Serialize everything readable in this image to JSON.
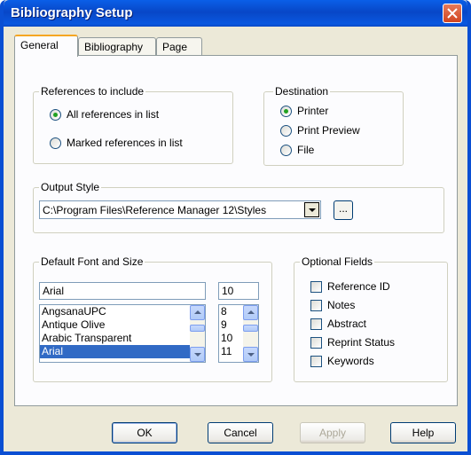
{
  "window": {
    "title": "Bibliography Setup"
  },
  "tabs": [
    {
      "label": "General",
      "active": true
    },
    {
      "label": "Bibliography",
      "active": false
    },
    {
      "label": "Page",
      "active": false
    }
  ],
  "references_group": {
    "title": "References to include",
    "options": [
      {
        "label": "All references in list",
        "selected": true
      },
      {
        "label": "Marked references in list",
        "selected": false
      }
    ]
  },
  "destination_group": {
    "title": "Destination",
    "options": [
      {
        "label": "Printer",
        "selected": true
      },
      {
        "label": "Print Preview",
        "selected": false
      },
      {
        "label": "File",
        "selected": false
      }
    ]
  },
  "output_style": {
    "title": "Output Style",
    "value": "C:\\Program Files\\Reference Manager 12\\Styles",
    "browse_label": "..."
  },
  "font_group": {
    "title": "Default Font and Size",
    "font_value": "Arial",
    "size_value": "10",
    "fonts": [
      "AngsanaUPC",
      "Antique Olive",
      "Arabic Transparent",
      "Arial"
    ],
    "selected_font": "Arial",
    "sizes": [
      "8",
      "9",
      "10",
      "11"
    ]
  },
  "optional_fields": {
    "title": "Optional Fields",
    "items": [
      {
        "label": "Reference ID",
        "checked": false
      },
      {
        "label": "Notes",
        "checked": false
      },
      {
        "label": "Abstract",
        "checked": false
      },
      {
        "label": "Reprint Status",
        "checked": false
      },
      {
        "label": "Keywords",
        "checked": false
      }
    ]
  },
  "buttons": {
    "ok": "OK",
    "cancel": "Cancel",
    "apply": "Apply",
    "help": "Help"
  },
  "colors": {
    "titlebar": "#0a4fd3",
    "selection": "#316ac5",
    "close": "#d2441f"
  },
  "icons": {
    "close": "close-icon",
    "dropdown": "chevron-down-icon",
    "scroll_up": "arrow-up-icon",
    "scroll_down": "arrow-down-icon"
  }
}
